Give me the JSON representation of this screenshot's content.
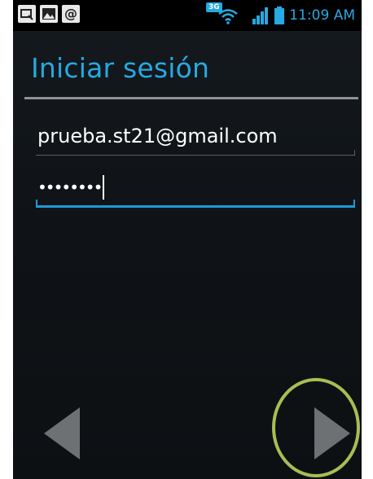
{
  "status_bar": {
    "time": "11:09 AM",
    "network_badge": "3G",
    "icons": [
      "notification-icon",
      "gallery-icon",
      "email-icon",
      "wifi-icon",
      "signal-icon",
      "battery-icon"
    ]
  },
  "screen": {
    "title": "Iniciar sesión",
    "email_value": "prueba.st21@gmail.com",
    "password_value": "••••••••"
  },
  "navigation": {
    "back": "back-arrow-icon",
    "next": "next-arrow-icon"
  },
  "colors": {
    "accent": "#27a9e1",
    "focus_line": "#1d9ad6",
    "highlight": "#a7bf52",
    "disabled_arrow": "#6d7174"
  }
}
